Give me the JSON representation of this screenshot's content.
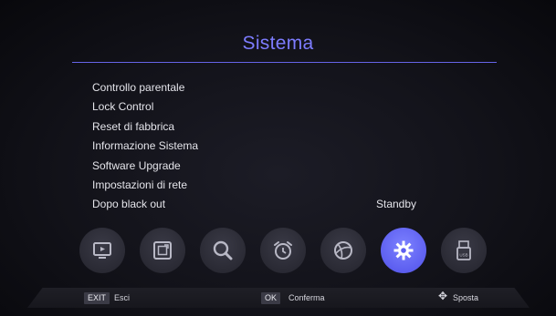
{
  "title": "Sistema",
  "menu": {
    "items": [
      {
        "label": "Controllo parentale",
        "value": ""
      },
      {
        "label": "Lock Control",
        "value": ""
      },
      {
        "label": "Reset di fabbrica",
        "value": ""
      },
      {
        "label": "Informazione Sistema",
        "value": ""
      },
      {
        "label": "Software Upgrade",
        "value": ""
      },
      {
        "label": "Impostazioni di rete",
        "value": ""
      },
      {
        "label": "Dopo black out",
        "value": "Standby"
      }
    ]
  },
  "icons": [
    {
      "name": "tv-icon",
      "active": false
    },
    {
      "name": "picture-icon",
      "active": false
    },
    {
      "name": "search-icon",
      "active": false
    },
    {
      "name": "alarm-clock-icon",
      "active": false
    },
    {
      "name": "globe-icon",
      "active": false
    },
    {
      "name": "gear-icon",
      "active": true
    },
    {
      "name": "usb-icon",
      "active": false
    }
  ],
  "footer": {
    "exit_key": "EXIT",
    "exit_label": "Esci",
    "ok_key": "OK",
    "ok_label": "Conferma",
    "move_label": "Sposta"
  },
  "colors": {
    "accent": "#7d7cff",
    "active_icon": "#5d5ff0"
  }
}
